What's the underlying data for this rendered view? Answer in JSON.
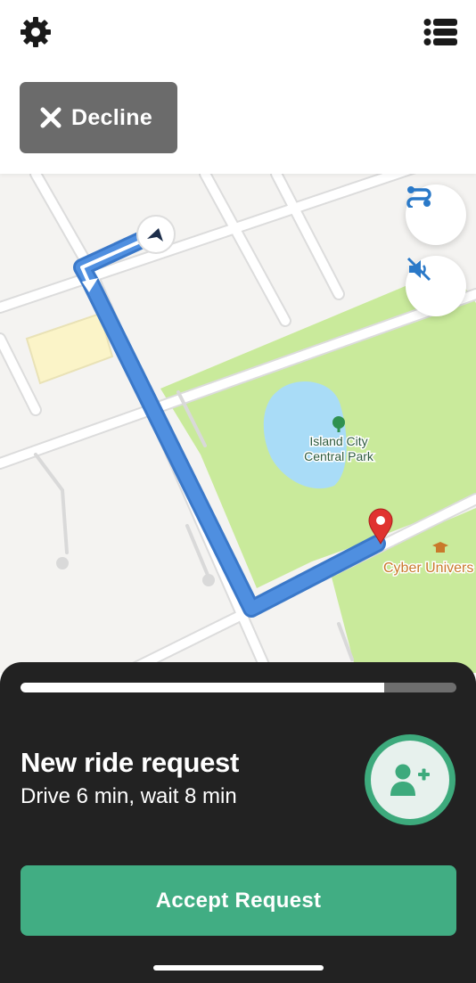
{
  "toolbar": {
    "settings_icon": "gear-icon",
    "list_icon": "list-icon",
    "decline_label": "Decline"
  },
  "map": {
    "park_name": [
      "Island City",
      "Central Park"
    ],
    "poi_label": "Cyber Univers",
    "colors": {
      "park": "#c9ea9b",
      "water": "#a9dcf7",
      "route": "#4f8fe0",
      "destination_pin": "#e0332f",
      "poi": "#c9792b"
    },
    "buttons": {
      "route_icon": "route-icon",
      "mute_icon": "volume-mute-icon"
    }
  },
  "sheet": {
    "progress_fraction": 0.835,
    "title": "New ride request",
    "subtitle": "Drive 6 min, wait 8 min",
    "add_rider_icon": "add-user-icon",
    "accept_label": "Accept Request",
    "colors": {
      "background": "#222222",
      "accent": "#41ad83"
    }
  }
}
